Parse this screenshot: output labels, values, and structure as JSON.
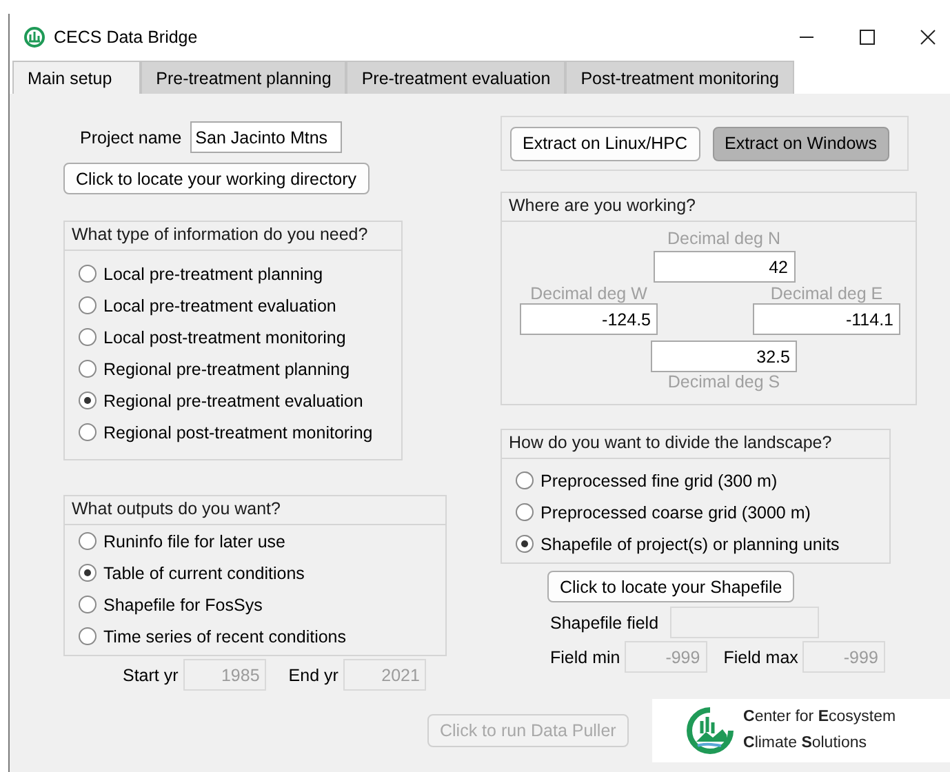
{
  "window": {
    "title": "CECS Data Bridge"
  },
  "tabs": [
    {
      "label": "Main setup",
      "selected": true
    },
    {
      "label": "Pre-treatment planning",
      "selected": false
    },
    {
      "label": "Pre-treatment evaluation",
      "selected": false
    },
    {
      "label": "Post-treatment monitoring",
      "selected": false
    }
  ],
  "project": {
    "label": "Project name",
    "value": "San Jacinto Mtns"
  },
  "locate_directory_button": {
    "label": "Click to locate your working directory"
  },
  "information_type": {
    "title": "What type of information do you need?",
    "options": [
      {
        "label": "Local pre-treatment planning",
        "selected": false
      },
      {
        "label": "Local pre-treatment evaluation",
        "selected": false
      },
      {
        "label": "Local post-treatment monitoring",
        "selected": false
      },
      {
        "label": "Regional pre-treatment planning",
        "selected": false
      },
      {
        "label": "Regional pre-treatment evaluation",
        "selected": true
      },
      {
        "label": "Regional post-treatment monitoring",
        "selected": false
      }
    ]
  },
  "outputs": {
    "title": "What outputs do you want?",
    "options": [
      {
        "label": "Runinfo file for later use",
        "selected": false
      },
      {
        "label": "Table of current conditions",
        "selected": true
      },
      {
        "label": "Shapefile for FosSys",
        "selected": false
      },
      {
        "label": "Time series of recent conditions",
        "selected": false
      }
    ]
  },
  "years": {
    "start_label": "Start yr",
    "start_value": "1985",
    "end_label": "End yr",
    "end_value": "2021",
    "disabled": true
  },
  "extract_buttons": [
    {
      "label": "Extract on Linux/HPC",
      "selected": false
    },
    {
      "label": "Extract on Windows",
      "selected": true
    }
  ],
  "location": {
    "title": "Where are you working?",
    "fields": [
      {
        "kind": "north",
        "label": "Decimal deg N",
        "value": "42"
      },
      {
        "kind": "west",
        "label": "Decimal deg W",
        "value": "-124.5"
      },
      {
        "kind": "east",
        "label": "Decimal deg E",
        "value": "-114.1"
      },
      {
        "kind": "south",
        "label": "Decimal deg S",
        "value": "32.5"
      }
    ]
  },
  "landscape": {
    "title": "How do you want to divide the landscape?",
    "options": [
      {
        "label": "Preprocessed fine grid (300 m)",
        "selected": false
      },
      {
        "label": "Preprocessed coarse grid (3000 m)",
        "selected": false
      },
      {
        "label": "Shapefile of project(s) or planning units",
        "selected": true
      }
    ]
  },
  "shapefile": {
    "button": "Click to locate your Shapefile",
    "field_label": "Shapefile field",
    "min_label": "Field min",
    "min_value": "-999",
    "max_label": "Field max",
    "max_value": "-999",
    "disabled": true
  },
  "run_button": {
    "label": "Click to run Data Puller",
    "disabled": true
  },
  "logo": {
    "lines": [
      "**C**enter for **E**cosystem",
      "**C**limate **S**olutions"
    ]
  }
}
